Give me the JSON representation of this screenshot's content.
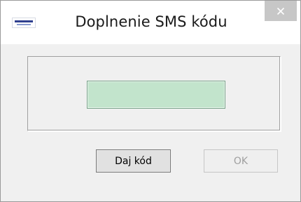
{
  "window": {
    "title": "Doplnenie SMS kódu",
    "close_icon": "close-icon"
  },
  "form": {
    "sms_code_value": "",
    "input_color": "#c2e4cc"
  },
  "buttons": {
    "get_code_label": "Daj kód",
    "ok_label": "OK",
    "ok_enabled": false
  },
  "icons": {
    "app": "app-logo-icon",
    "close": "close-icon"
  }
}
